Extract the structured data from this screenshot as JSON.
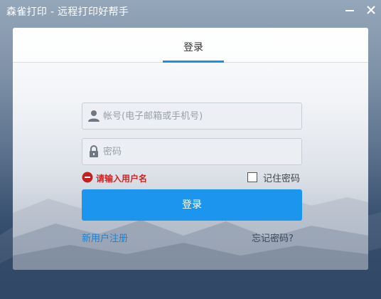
{
  "window": {
    "title": "森雀打印 - 远程打印好帮手"
  },
  "tabs": {
    "login_label": "登录"
  },
  "form": {
    "username_placeholder": "帐号(电子邮箱或手机号)",
    "username_value": "",
    "password_placeholder": "密码",
    "password_value": "",
    "error_message": "请输入用户名",
    "remember_label": "记住密码",
    "remember_checked": false,
    "login_button": "登录"
  },
  "links": {
    "register": "新用户注册",
    "forgot": "忘记密码?"
  },
  "icons": {
    "minimize": "minimize-icon",
    "close": "close-icon",
    "user": "user-icon",
    "lock": "lock-icon",
    "error": "error-icon"
  },
  "colors": {
    "accent": "#1b95ee",
    "error": "#d12424",
    "link": "#1a84d6"
  }
}
